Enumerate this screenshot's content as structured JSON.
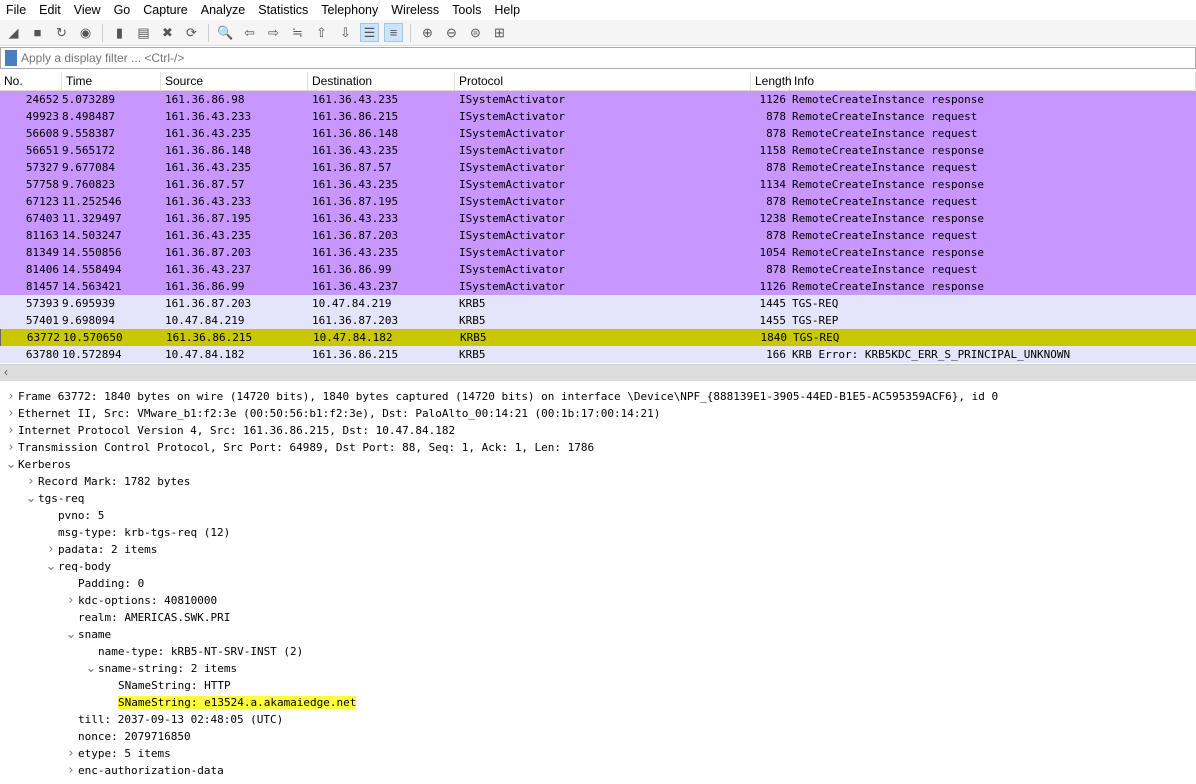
{
  "menu": [
    "File",
    "Edit",
    "View",
    "Go",
    "Capture",
    "Analyze",
    "Statistics",
    "Telephony",
    "Wireless",
    "Tools",
    "Help"
  ],
  "toolbar": [
    {
      "icon": "shark-fin-start-icon",
      "g": "◢"
    },
    {
      "icon": "stop-icon",
      "g": "■"
    },
    {
      "icon": "restart-icon",
      "g": "↻"
    },
    {
      "icon": "capture-options-icon",
      "g": "◉"
    },
    {
      "sep": true
    },
    {
      "icon": "open-file-icon",
      "g": "▮"
    },
    {
      "icon": "save-file-icon",
      "g": "▤"
    },
    {
      "icon": "close-file-icon",
      "g": "✖"
    },
    {
      "icon": "reload-file-icon",
      "g": "⟳"
    },
    {
      "sep": true
    },
    {
      "icon": "find-packet-icon",
      "g": "🔍"
    },
    {
      "icon": "go-back-icon",
      "g": "⇦"
    },
    {
      "icon": "go-forward-icon",
      "g": "⇨"
    },
    {
      "icon": "go-to-packet-icon",
      "g": "≒"
    },
    {
      "icon": "go-first-icon",
      "g": "⇧"
    },
    {
      "icon": "go-last-icon",
      "g": "⇩"
    },
    {
      "icon": "autoscroll-icon",
      "g": "☰",
      "on": true
    },
    {
      "icon": "colorize-icon",
      "g": "≡",
      "on": true
    },
    {
      "sep": true
    },
    {
      "icon": "zoom-in-icon",
      "g": "⊕"
    },
    {
      "icon": "zoom-out-icon",
      "g": "⊖"
    },
    {
      "icon": "zoom-reset-icon",
      "g": "⊜"
    },
    {
      "icon": "resize-columns-icon",
      "g": "⊞"
    }
  ],
  "filter": {
    "placeholder": "Apply a display filter ... <Ctrl-/>"
  },
  "columns": [
    "No.",
    "Time",
    "Source",
    "Destination",
    "Protocol",
    "Length",
    "Info"
  ],
  "colors": {
    "isystem": "#c797ff",
    "krb": "#e4e4fa",
    "selected": "#c8c800",
    "highlight": "#ffff3c"
  },
  "packets": [
    [
      "24652",
      "5.073289",
      "161.36.86.98",
      "161.36.43.235",
      "ISystemActivator",
      "1126",
      "RemoteCreateInstance response",
      "isystem"
    ],
    [
      "49923",
      "8.498487",
      "161.36.43.233",
      "161.36.86.215",
      "ISystemActivator",
      "878",
      "RemoteCreateInstance request",
      "isystem"
    ],
    [
      "56608",
      "9.558387",
      "161.36.43.235",
      "161.36.86.148",
      "ISystemActivator",
      "878",
      "RemoteCreateInstance request",
      "isystem"
    ],
    [
      "56651",
      "9.565172",
      "161.36.86.148",
      "161.36.43.235",
      "ISystemActivator",
      "1158",
      "RemoteCreateInstance response",
      "isystem"
    ],
    [
      "57327",
      "9.677084",
      "161.36.43.235",
      "161.36.87.57",
      "ISystemActivator",
      "878",
      "RemoteCreateInstance request",
      "isystem"
    ],
    [
      "57758",
      "9.760823",
      "161.36.87.57",
      "161.36.43.235",
      "ISystemActivator",
      "1134",
      "RemoteCreateInstance response",
      "isystem"
    ],
    [
      "67123",
      "11.252546",
      "161.36.43.233",
      "161.36.87.195",
      "ISystemActivator",
      "878",
      "RemoteCreateInstance request",
      "isystem"
    ],
    [
      "67403",
      "11.329497",
      "161.36.87.195",
      "161.36.43.233",
      "ISystemActivator",
      "1238",
      "RemoteCreateInstance response",
      "isystem"
    ],
    [
      "81163",
      "14.503247",
      "161.36.43.235",
      "161.36.87.203",
      "ISystemActivator",
      "878",
      "RemoteCreateInstance request",
      "isystem"
    ],
    [
      "81349",
      "14.550856",
      "161.36.87.203",
      "161.36.43.235",
      "ISystemActivator",
      "1054",
      "RemoteCreateInstance response",
      "isystem"
    ],
    [
      "81406",
      "14.558494",
      "161.36.43.237",
      "161.36.86.99",
      "ISystemActivator",
      "878",
      "RemoteCreateInstance request",
      "isystem"
    ],
    [
      "81457",
      "14.563421",
      "161.36.86.99",
      "161.36.43.237",
      "ISystemActivator",
      "1126",
      "RemoteCreateInstance response",
      "isystem"
    ],
    [
      "57393",
      "9.695939",
      "161.36.87.203",
      "10.47.84.219",
      "KRB5",
      "1445",
      "TGS-REQ",
      "krb"
    ],
    [
      "57401",
      "9.698094",
      "10.47.84.219",
      "161.36.87.203",
      "KRB5",
      "1455",
      "TGS-REP",
      "krb"
    ],
    [
      "63772",
      "10.570650",
      "161.36.86.215",
      "10.47.84.182",
      "KRB5",
      "1840",
      "TGS-REQ",
      "selected"
    ],
    [
      "63780",
      "10.572894",
      "10.47.84.182",
      "161.36.86.215",
      "KRB5",
      "166",
      "KRB Error: KRB5KDC_ERR_S_PRINCIPAL_UNKNOWN",
      "krb"
    ]
  ],
  "details": [
    {
      "d": 0,
      "a": ">",
      "t": "Frame 63772: 1840 bytes on wire (14720 bits), 1840 bytes captured (14720 bits) on interface \\Device\\NPF_{888139E1-3905-44ED-B1E5-AC595359ACF6}, id 0"
    },
    {
      "d": 0,
      "a": ">",
      "t": "Ethernet II, Src: VMware_b1:f2:3e (00:50:56:b1:f2:3e), Dst: PaloAlto_00:14:21 (00:1b:17:00:14:21)"
    },
    {
      "d": 0,
      "a": ">",
      "t": "Internet Protocol Version 4, Src: 161.36.86.215, Dst: 10.47.84.182"
    },
    {
      "d": 0,
      "a": ">",
      "t": "Transmission Control Protocol, Src Port: 64989, Dst Port: 88, Seq: 1, Ack: 1, Len: 1786"
    },
    {
      "d": 0,
      "a": "v",
      "t": "Kerberos"
    },
    {
      "d": 1,
      "a": ">",
      "t": "Record Mark: 1782 bytes"
    },
    {
      "d": 1,
      "a": "v",
      "t": "tgs-req"
    },
    {
      "d": 2,
      "a": "",
      "t": "pvno: 5"
    },
    {
      "d": 2,
      "a": "",
      "t": "msg-type: krb-tgs-req (12)"
    },
    {
      "d": 2,
      "a": ">",
      "t": "padata: 2 items"
    },
    {
      "d": 2,
      "a": "v",
      "t": "req-body"
    },
    {
      "d": 3,
      "a": "",
      "t": "Padding: 0"
    },
    {
      "d": 3,
      "a": ">",
      "t": "kdc-options: 40810000"
    },
    {
      "d": 3,
      "a": "",
      "t": "realm: AMERICAS.SWK.PRI"
    },
    {
      "d": 3,
      "a": "v",
      "t": "sname"
    },
    {
      "d": 4,
      "a": "",
      "t": "name-type: kRB5-NT-SRV-INST (2)"
    },
    {
      "d": 4,
      "a": "v",
      "t": "sname-string: 2 items"
    },
    {
      "d": 5,
      "a": "",
      "t": "SNameString: HTTP"
    },
    {
      "d": 5,
      "a": "",
      "t": "SNameString: e13524.a.akamaiedge.net",
      "hl": true
    },
    {
      "d": 3,
      "a": "",
      "t": "till: 2037-09-13 02:48:05 (UTC)"
    },
    {
      "d": 3,
      "a": "",
      "t": "nonce: 2079716850"
    },
    {
      "d": 3,
      "a": ">",
      "t": "etype: 5 items"
    },
    {
      "d": 3,
      "a": ">",
      "t": "enc-authorization-data"
    }
  ]
}
